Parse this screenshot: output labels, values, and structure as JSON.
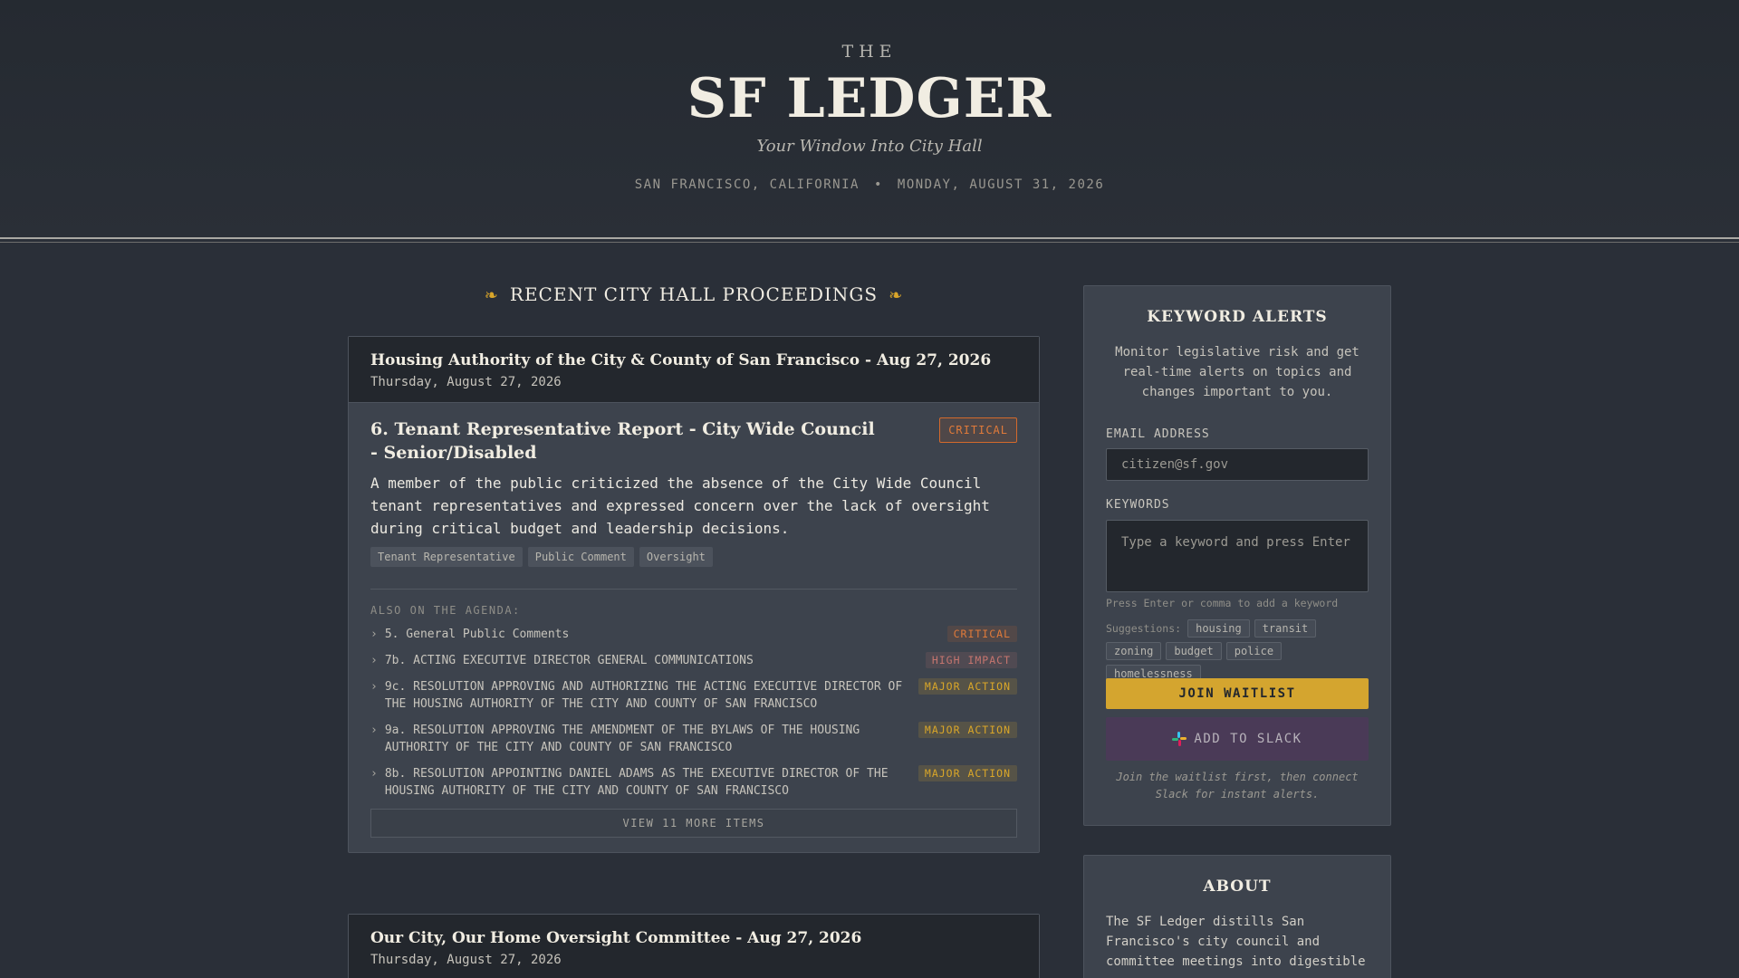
{
  "masthead": {
    "kicker": "THE",
    "title": "SF LEDGER",
    "tagline": "Your Window Into City Hall",
    "location": "SAN FRANCISCO, CALIFORNIA",
    "separator": "•",
    "date": "MONDAY, AUGUST 31, 2026"
  },
  "main": {
    "heading": "RECENT CITY HALL PROCEEDINGS",
    "fleuron": "❧",
    "meetings": [
      {
        "title": "Housing Authority of the City & County of San Francisco - Aug 27, 2026",
        "date": "Thursday, August 27, 2026",
        "featured": {
          "title": "6. Tenant Representative Report - City Wide Council - Senior/Disabled",
          "badge": "CRITICAL",
          "summary": "A member of the public criticized the absence of the City Wide Council tenant representatives and expressed concern over the lack of oversight during critical budget and leadership decisions.",
          "tags": [
            "Tenant Representative",
            "Public Comment",
            "Oversight"
          ]
        },
        "also_label": "ALSO ON THE AGENDA:",
        "agenda": [
          {
            "text": "5. General Public Comments",
            "badge": "CRITICAL",
            "level": "critical"
          },
          {
            "text": "7b. ACTING EXECUTIVE DIRECTOR GENERAL COMMUNICATIONS",
            "badge": "HIGH IMPACT",
            "level": "high"
          },
          {
            "text": "9c. RESOLUTION APPROVING AND AUTHORIZING THE ACTING EXECUTIVE DIRECTOR OF THE HOUSING AUTHORITY OF THE CITY AND COUNTY OF SAN FRANCISCO",
            "badge": "MAJOR ACTION",
            "level": "major"
          },
          {
            "text": "9a. RESOLUTION APPROVING THE AMENDMENT OF THE BYLAWS OF THE HOUSING AUTHORITY OF THE CITY AND COUNTY OF SAN FRANCISCO",
            "badge": "MAJOR ACTION",
            "level": "major"
          },
          {
            "text": "8b. RESOLUTION APPOINTING DANIEL ADAMS AS THE EXECUTIVE DIRECTOR OF THE HOUSING AUTHORITY OF THE CITY AND COUNTY OF SAN FRANCISCO",
            "badge": "MAJOR ACTION",
            "level": "major"
          }
        ],
        "view_more": "VIEW 11 MORE ITEMS"
      },
      {
        "title": "Our City, Our Home Oversight Committee - Aug 27, 2026",
        "date": "Thursday, August 27, 2026"
      }
    ]
  },
  "alerts": {
    "title": "KEYWORD ALERTS",
    "description": "Monitor legislative risk and get real-time alerts on topics and changes important to you.",
    "email_label": "EMAIL ADDRESS",
    "email_placeholder": "citizen@sf.gov",
    "keywords_label": "KEYWORDS",
    "keywords_placeholder": "Type a keyword and press Enter",
    "hint": "Press Enter or comma to add a keyword",
    "suggestions_label": "Suggestions:",
    "suggestions": [
      "housing",
      "transit",
      "zoning",
      "budget",
      "police",
      "homelessness"
    ],
    "waitlist_button": "JOIN WAITLIST",
    "slack_button": "ADD TO SLACK",
    "footnote": "Join the waitlist first, then connect Slack for instant alerts."
  },
  "about": {
    "title": "ABOUT",
    "text": "The SF Ledger distills San Francisco's city council and committee meetings into digestible"
  },
  "colors": {
    "background": "#2a2f38",
    "accent_gold": "#d4a52f",
    "critical": "#e07a3a",
    "high_impact": "#c5756f",
    "slack_button": "#4a3a57"
  }
}
